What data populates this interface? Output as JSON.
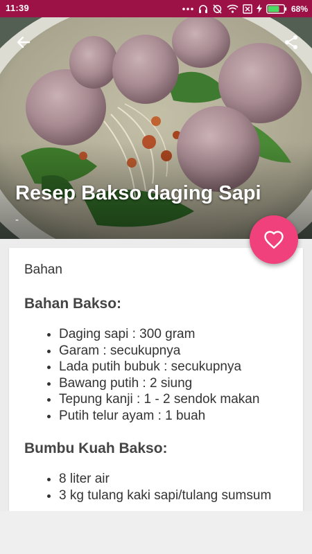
{
  "status_bar": {
    "time": "11:39",
    "battery": "68%",
    "icons": [
      "more-dots-icon",
      "headset-icon",
      "alarm-off-icon",
      "wifi-icon",
      "sim-icon",
      "charging-icon",
      "battery-icon"
    ],
    "color": "#9c1146"
  },
  "toolbar": {
    "back_icon": "arrow-left-icon",
    "share_icon": "share-icon"
  },
  "hero": {
    "title": "Resep Bakso daging Sapi",
    "subtitle": "-"
  },
  "fab": {
    "icon": "heart-outline-icon",
    "color": "#f0417c"
  },
  "recipe": {
    "intro": "Bahan",
    "sections": [
      {
        "heading": "Bahan Bakso:",
        "items": [
          "Daging sapi : 300 gram",
          "Garam : secukupnya",
          "Lada putih bubuk : secukupnya",
          "Bawang putih : 2 siung",
          "Tepung kanji : 1 - 2 sendok makan",
          "Putih telur ayam : 1 buah"
        ]
      },
      {
        "heading": "Bumbu Kuah Bakso:",
        "items": [
          "8 liter air",
          "3 kg tulang kaki sapi/tulang sumsum"
        ]
      }
    ]
  }
}
